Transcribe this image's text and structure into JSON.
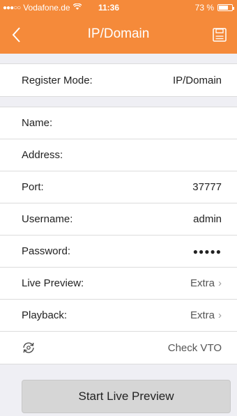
{
  "status_bar": {
    "signal": "●●●○○",
    "carrier": "Vodafone.de",
    "wifi_icon": "wifi-icon",
    "time": "11:36",
    "battery_text": "73 %",
    "battery_level": 0.73
  },
  "nav": {
    "back_icon": "chevron-left-icon",
    "title": "IP/Domain",
    "save_icon": "floppy-disk-icon"
  },
  "register_mode": {
    "label": "Register Mode:",
    "value": "IP/Domain"
  },
  "fields": {
    "name": {
      "label": "Name:",
      "value": ""
    },
    "address": {
      "label": "Address:",
      "value": ""
    },
    "port": {
      "label": "Port:",
      "value": "37777"
    },
    "username": {
      "label": "Username:",
      "value": "admin"
    },
    "password": {
      "label": "Password:",
      "value": "●●●●●"
    },
    "live_preview": {
      "label": "Live Preview:",
      "value": "Extra"
    },
    "playback": {
      "label": "Playback:",
      "value": "Extra"
    },
    "check_vto": {
      "icon": "refresh-cycle-icon",
      "label": "Check VTO"
    }
  },
  "chevron": "›",
  "primary_button": {
    "label": "Start Live Preview"
  },
  "colors": {
    "accent": "#f58a3a",
    "background": "#efeff4",
    "button": "#d6d6d6"
  }
}
